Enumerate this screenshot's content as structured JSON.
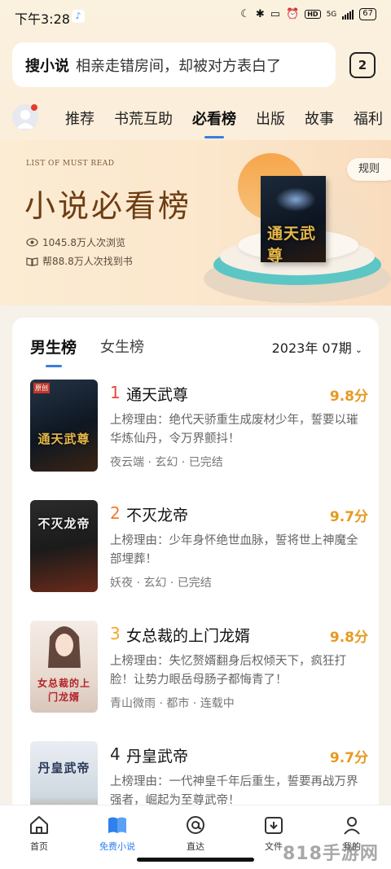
{
  "status_bar": {
    "time": "下午3:28",
    "network": "5G",
    "hd": "HD",
    "battery": "67"
  },
  "search": {
    "brand": "搜小说",
    "query": "相亲走错房间，却被对方表白了",
    "tab_count": "2"
  },
  "nav": {
    "tabs": [
      {
        "label": "推荐"
      },
      {
        "label": "书荒互助"
      },
      {
        "label": "必看榜"
      },
      {
        "label": "出版"
      },
      {
        "label": "故事"
      },
      {
        "label": "福利"
      }
    ],
    "active_index": 2
  },
  "banner": {
    "subtitle_en": "LIST OF MUST READ",
    "title": "小说必看榜",
    "views": "1045.8万人次浏览",
    "found": "帮88.8万人次找到书",
    "rules_label": "规则",
    "cover_title": "通天武尊"
  },
  "ranking": {
    "tabs": [
      {
        "label": "男生榜"
      },
      {
        "label": "女生榜"
      }
    ],
    "period": "2023年 07期",
    "books": [
      {
        "rank": "1",
        "title": "通天武尊",
        "score": "9.8分",
        "reason": "上榜理由：绝代天骄重生成废材少年，誓要以璀华炼仙丹，令万界颤抖！",
        "meta": "夜云端 · 玄幻 · 已完结",
        "cover_text": "通天武尊",
        "cover_tag": "原创",
        "rank_color": "#e8473a"
      },
      {
        "rank": "2",
        "title": "不灭龙帝",
        "score": "9.7分",
        "reason": "上榜理由：少年身怀绝世血脉，誓将世上神魔全部埋葬！",
        "meta": "妖夜 · 玄幻 · 已完结",
        "cover_text": "不灭龙帝",
        "rank_color": "#ef7b2d"
      },
      {
        "rank": "3",
        "title": "女总裁的上门龙婿",
        "score": "9.8分",
        "reason": "上榜理由：失忆赘婿翻身后权倾天下，疯狂打脸！让势力眼岳母肠子都悔青了！",
        "meta": "青山微雨 · 都市 · 连载中",
        "cover_text": "女总裁的上门龙婿",
        "rank_color": "#f0a825"
      },
      {
        "rank": "4",
        "title": "丹皇武帝",
        "score": "9.7分",
        "reason": "上榜理由：一代神皇千年后重生，誓要再战万界强者，崛起为至尊武帝！",
        "meta": "",
        "cover_text": "丹皇武帝",
        "rank_color": "#222222"
      }
    ]
  },
  "bottom_nav": [
    {
      "label": "首页",
      "icon": "home-icon"
    },
    {
      "label": "免费小说",
      "icon": "book-icon"
    },
    {
      "label": "直达",
      "icon": "at-icon"
    },
    {
      "label": "文件",
      "icon": "folder-icon"
    },
    {
      "label": "我的",
      "icon": "profile-icon"
    }
  ],
  "watermark": "818手游网",
  "colors": {
    "accent": "#3a7de0",
    "score": "#e69a1f",
    "banner_title": "#6e3d13"
  }
}
